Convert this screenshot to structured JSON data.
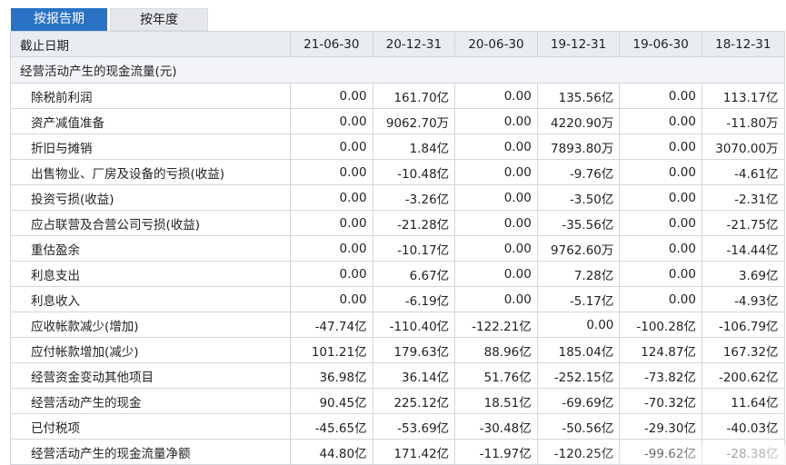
{
  "tabs": [
    {
      "label": "按报告期",
      "active": true
    },
    {
      "label": "按年度",
      "active": false
    }
  ],
  "table": {
    "header_label": "截止日期",
    "dates": [
      "21-06-30",
      "20-12-31",
      "20-06-30",
      "19-12-31",
      "19-06-30",
      "18-12-31"
    ],
    "section_title": "经营活动产生的现金流量(元)",
    "rows": [
      {
        "name": "除税前利润",
        "values": [
          "0.00",
          "161.70亿",
          "0.00",
          "135.56亿",
          "0.00",
          "113.17亿"
        ]
      },
      {
        "name": "资产减值准备",
        "values": [
          "0.00",
          "9062.70万",
          "0.00",
          "4220.90万",
          "0.00",
          "-11.80万"
        ]
      },
      {
        "name": "折旧与摊销",
        "values": [
          "0.00",
          "1.84亿",
          "0.00",
          "7893.80万",
          "0.00",
          "3070.00万"
        ]
      },
      {
        "name": "出售物业、厂房及设备的亏损(收益)",
        "values": [
          "0.00",
          "-10.48亿",
          "0.00",
          "-9.76亿",
          "0.00",
          "-4.61亿"
        ]
      },
      {
        "name": "投资亏损(收益)",
        "values": [
          "0.00",
          "-3.26亿",
          "0.00",
          "-3.50亿",
          "0.00",
          "-2.31亿"
        ]
      },
      {
        "name": "应占联营及合营公司亏损(收益)",
        "values": [
          "0.00",
          "-21.28亿",
          "0.00",
          "-35.56亿",
          "0.00",
          "-21.75亿"
        ]
      },
      {
        "name": "重估盈余",
        "values": [
          "0.00",
          "-10.17亿",
          "0.00",
          "9762.60万",
          "0.00",
          "-14.44亿"
        ]
      },
      {
        "name": "利息支出",
        "values": [
          "0.00",
          "6.67亿",
          "0.00",
          "7.28亿",
          "0.00",
          "3.69亿"
        ]
      },
      {
        "name": "利息收入",
        "values": [
          "0.00",
          "-6.19亿",
          "0.00",
          "-5.17亿",
          "0.00",
          "-4.93亿"
        ]
      },
      {
        "name": "应收帐款减少(增加)",
        "values": [
          "-47.74亿",
          "-110.40亿",
          "-122.21亿",
          "0.00",
          "-100.28亿",
          "-106.79亿"
        ]
      },
      {
        "name": "应付帐款增加(减少)",
        "values": [
          "101.21亿",
          "179.63亿",
          "88.96亿",
          "185.04亿",
          "124.87亿",
          "167.32亿"
        ]
      },
      {
        "name": "经营资金变动其他项目",
        "values": [
          "36.98亿",
          "36.14亿",
          "51.76亿",
          "-252.15亿",
          "-73.82亿",
          "-200.62亿"
        ]
      },
      {
        "name": "经营活动产生的现金",
        "values": [
          "90.45亿",
          "225.12亿",
          "18.51亿",
          "-69.69亿",
          "-70.32亿",
          "11.64亿"
        ]
      },
      {
        "name": "已付税项",
        "values": [
          "-45.65亿",
          "-53.69亿",
          "-30.48亿",
          "-50.56亿",
          "-29.30亿",
          "-40.03亿"
        ]
      },
      {
        "name": "经营活动产生的现金流量净额",
        "values": [
          "44.80亿",
          "171.42亿",
          "-11.97亿",
          "-120.25亿",
          "-99.62亿",
          "-28.38亿"
        ]
      }
    ]
  }
}
